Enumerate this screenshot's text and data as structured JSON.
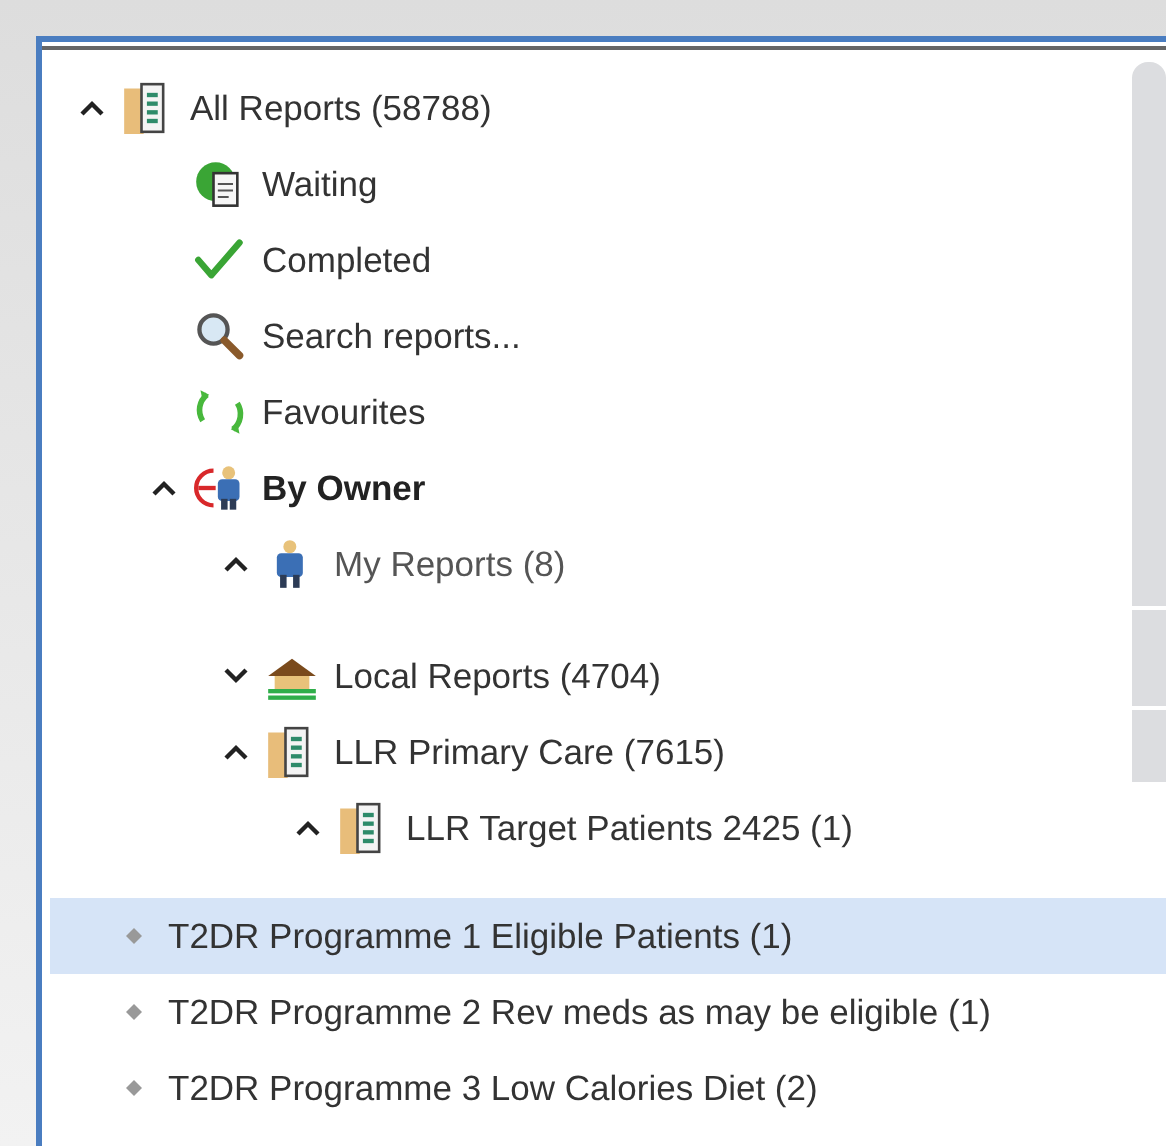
{
  "tree": [
    {
      "label": "All Reports (58788)",
      "kind": "folder",
      "expanded": true,
      "children": [
        {
          "label": "Waiting",
          "kind": "waiting"
        },
        {
          "label": "Completed",
          "kind": "completed"
        },
        {
          "label": "Search reports...",
          "kind": "search"
        },
        {
          "label": "Favourites",
          "kind": "favourites"
        },
        {
          "label": "By Owner",
          "kind": "owner",
          "expanded": true,
          "children": [
            {
              "label": "My Reports (8)",
              "kind": "person",
              "expanded": true
            },
            {
              "label": "Local Reports (4704)",
              "kind": "house",
              "expanded": false
            },
            {
              "label": "LLR Primary Care (7615)",
              "kind": "folder",
              "expanded": true,
              "children": [
                {
                  "label": "LLR Target Patients 2425 (1)",
                  "kind": "folder",
                  "expanded": true
                }
              ]
            }
          ]
        }
      ]
    }
  ],
  "reports": [
    {
      "label": "T2DR Programme 1 Eligible Patients (1)",
      "selected": true
    },
    {
      "label": "T2DR Programme 2 Rev meds as may be eligible (1)",
      "selected": false
    },
    {
      "label": "T2DR Programme 3 Low Calories Diet (2)",
      "selected": false
    }
  ]
}
